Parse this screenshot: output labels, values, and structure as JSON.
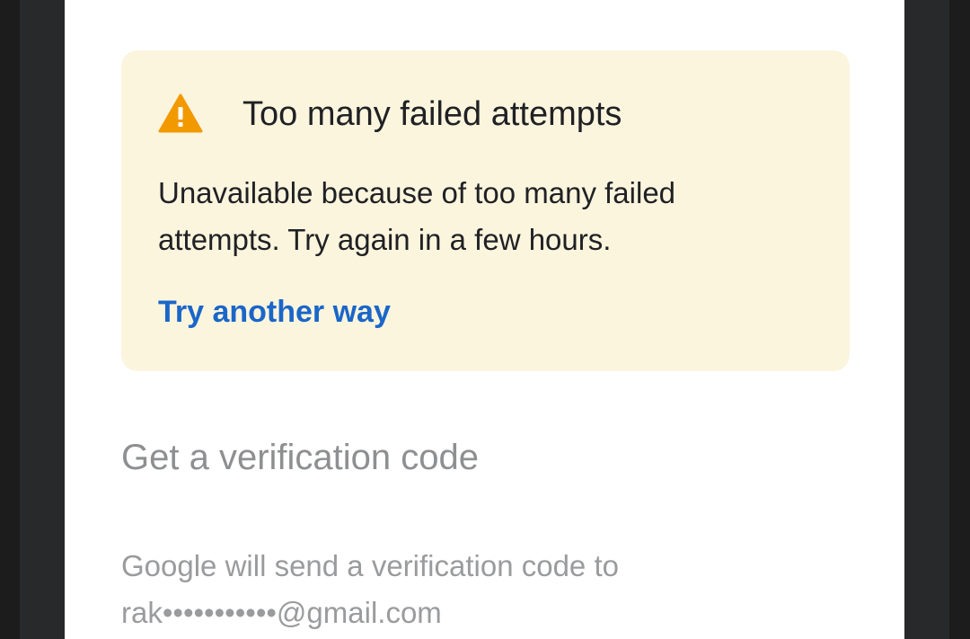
{
  "alert": {
    "icon": "warning-icon",
    "icon_color": "#f29900",
    "background_color": "#fcf5de",
    "title": "Too many failed attempts",
    "message": "Unavailable because of too many failed attempts. Try again in a few hours.",
    "link_label": "Try another way",
    "link_color": "#1a66c9"
  },
  "verification": {
    "title": "Get a verification code",
    "description": "Google will send a verification code to rak•••••••••••@gmail.com"
  }
}
